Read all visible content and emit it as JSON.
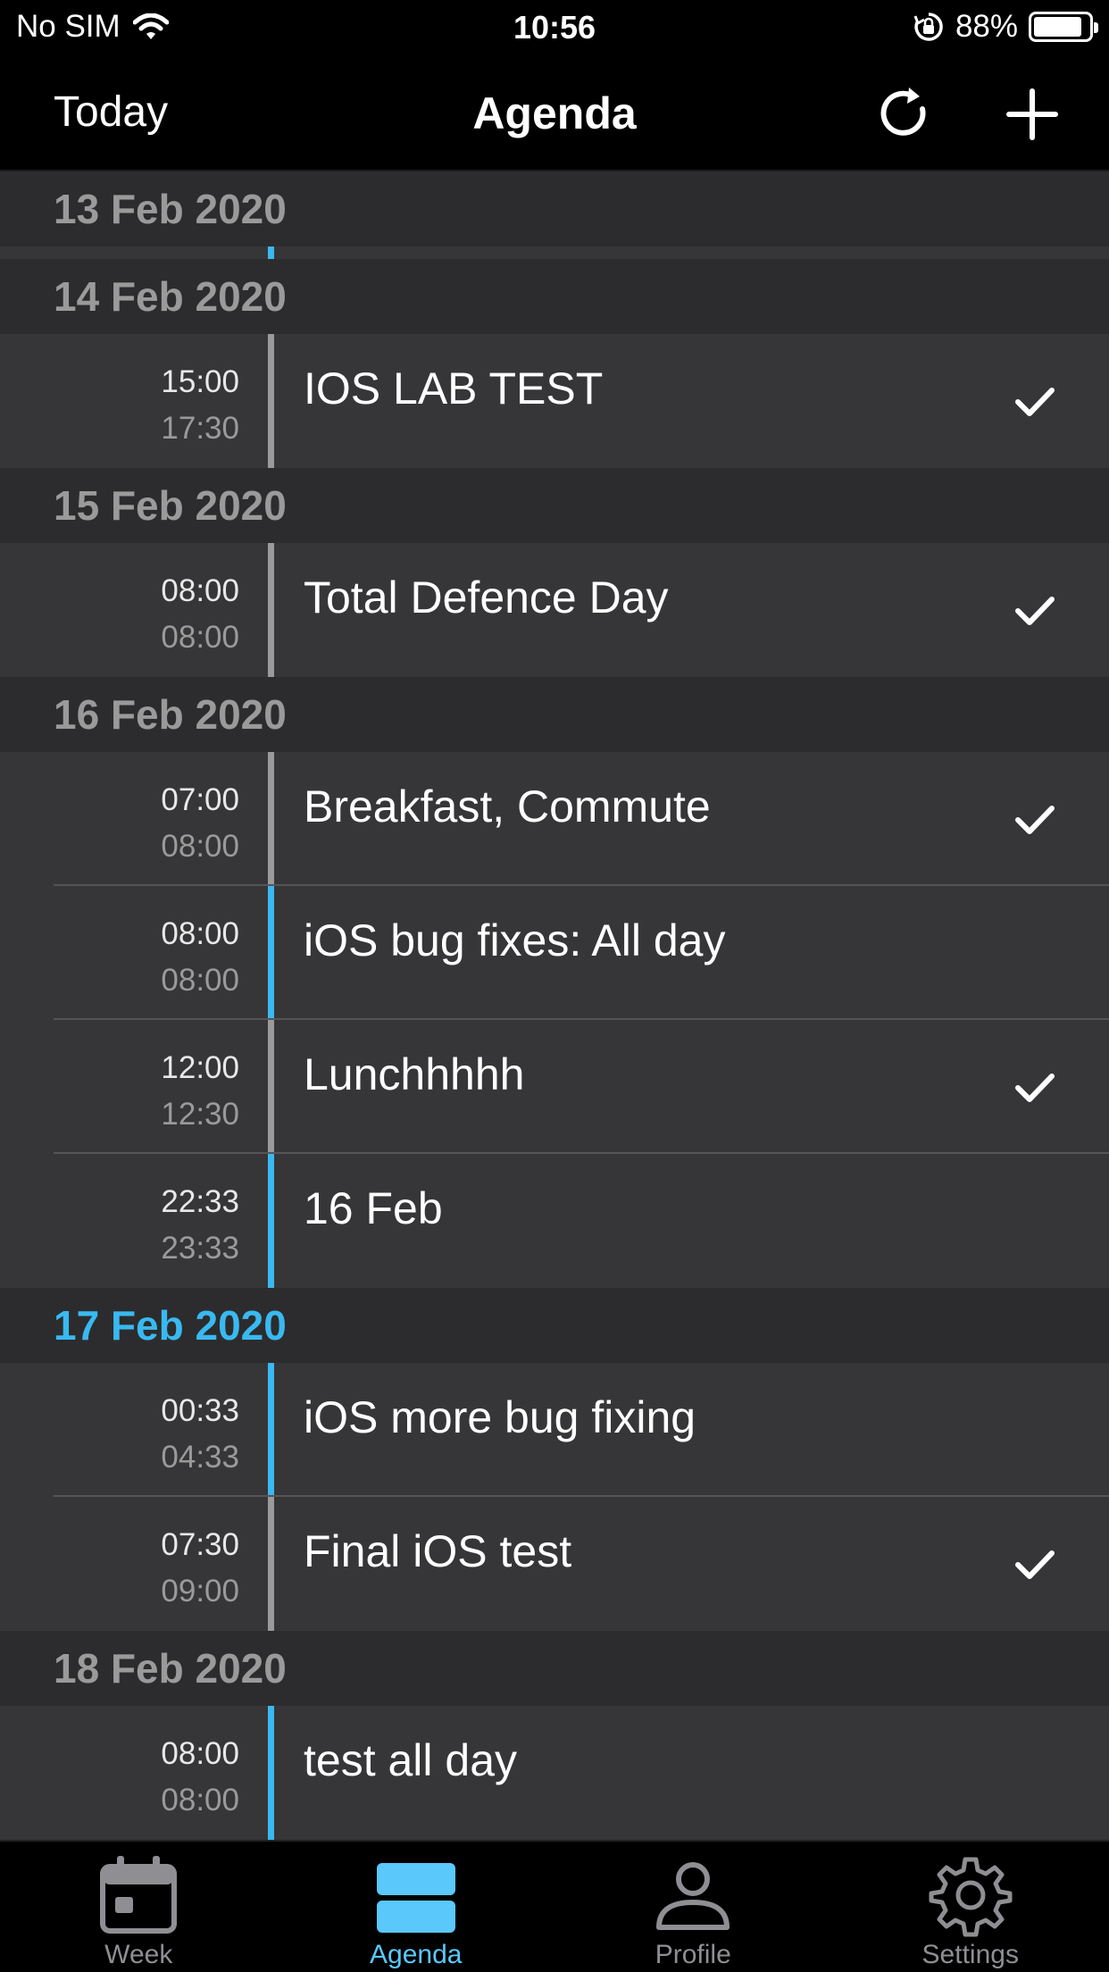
{
  "status_bar": {
    "carrier": "No SIM",
    "time": "10:56",
    "battery_percent": "88%",
    "battery_level": 0.88
  },
  "nav": {
    "left_label": "Today",
    "title": "Agenda",
    "refresh_icon": "refresh-icon",
    "add_icon": "plus-icon"
  },
  "colors": {
    "accent": "#39b9f0",
    "inactive_bar": "#9a9a9a",
    "row_bg": "#363638",
    "header_bg": "#2c2c2e"
  },
  "sections": [
    {
      "date": "13 Feb 2020",
      "today": false,
      "events": []
    },
    {
      "date": "14 Feb 2020",
      "today": false,
      "events": [
        {
          "start": "15:00",
          "end": "17:30",
          "title": "IOS LAB TEST",
          "done": true,
          "active": false
        }
      ]
    },
    {
      "date": "15 Feb 2020",
      "today": false,
      "events": [
        {
          "start": "08:00",
          "end": "08:00",
          "title": "Total Defence Day",
          "done": true,
          "active": false
        }
      ]
    },
    {
      "date": "16 Feb 2020",
      "today": false,
      "events": [
        {
          "start": "07:00",
          "end": "08:00",
          "title": "Breakfast, Commute",
          "done": true,
          "active": false
        },
        {
          "start": "08:00",
          "end": "08:00",
          "title": "iOS bug fixes: All day",
          "done": false,
          "active": true
        },
        {
          "start": "12:00",
          "end": "12:30",
          "title": "Lunchhhhh",
          "done": true,
          "active": false
        },
        {
          "start": "22:33",
          "end": "23:33",
          "title": "16 Feb",
          "done": false,
          "active": true
        }
      ]
    },
    {
      "date": "17 Feb 2020",
      "today": true,
      "events": [
        {
          "start": "00:33",
          "end": "04:33",
          "title": "iOS more bug fixing",
          "done": false,
          "active": true
        },
        {
          "start": "07:30",
          "end": "09:00",
          "title": "Final iOS test",
          "done": true,
          "active": false
        }
      ]
    },
    {
      "date": "18 Feb 2020",
      "today": false,
      "events": [
        {
          "start": "08:00",
          "end": "08:00",
          "title": "test all day",
          "done": false,
          "active": true
        }
      ]
    }
  ],
  "tabs": [
    {
      "label": "Week",
      "icon": "calendar-icon",
      "active": false
    },
    {
      "label": "Agenda",
      "icon": "agenda-icon",
      "active": true
    },
    {
      "label": "Profile",
      "icon": "person-icon",
      "active": false
    },
    {
      "label": "Settings",
      "icon": "gear-icon",
      "active": false
    }
  ]
}
